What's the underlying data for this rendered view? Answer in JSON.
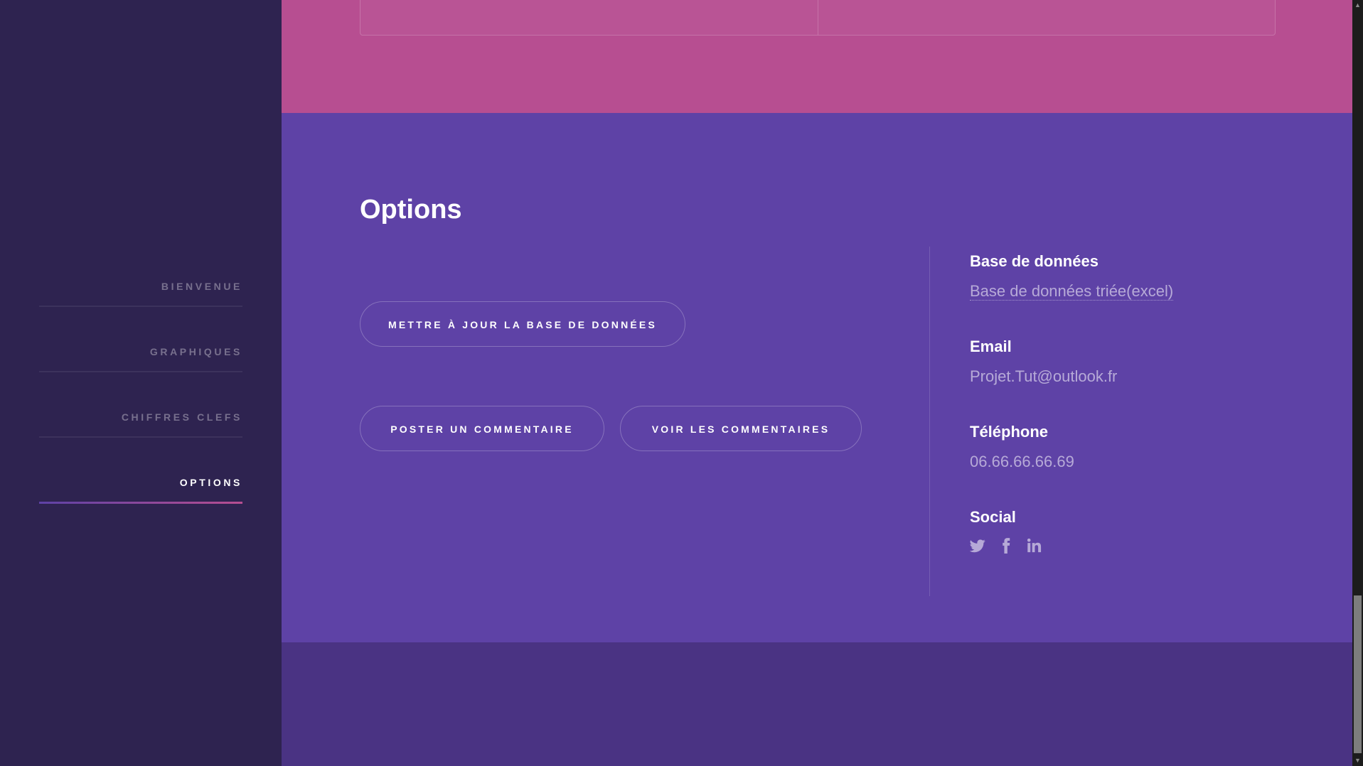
{
  "sidebar": {
    "items": [
      {
        "label": "BIENVENUE",
        "active": false
      },
      {
        "label": "GRAPHIQUES",
        "active": false
      },
      {
        "label": "CHIFFRES CLEFS",
        "active": false
      },
      {
        "label": "OPTIONS",
        "active": true
      }
    ]
  },
  "options": {
    "title": "Options",
    "buttons": {
      "update_db": "METTRE À JOUR LA BASE DE DONNÉES",
      "post_comment": "POSTER UN COMMENTAIRE",
      "view_comments": "VOIR LES COMMENTAIRES"
    },
    "info": {
      "database": {
        "heading": "Base de données",
        "value": "Base de données triée(excel)"
      },
      "email": {
        "heading": "Email",
        "value": "Projet.Tut@outlook.fr"
      },
      "phone": {
        "heading": "Téléphone",
        "value": "06.66.66.66.69"
      },
      "social": {
        "heading": "Social",
        "icons": [
          "twitter-icon",
          "facebook-icon",
          "linkedin-icon"
        ]
      }
    }
  },
  "colors": {
    "sidebar_bg": "#2e2350",
    "pink_section": "#b74e91",
    "purple_section": "#5e42a6",
    "footer_section": "#4a3383"
  }
}
